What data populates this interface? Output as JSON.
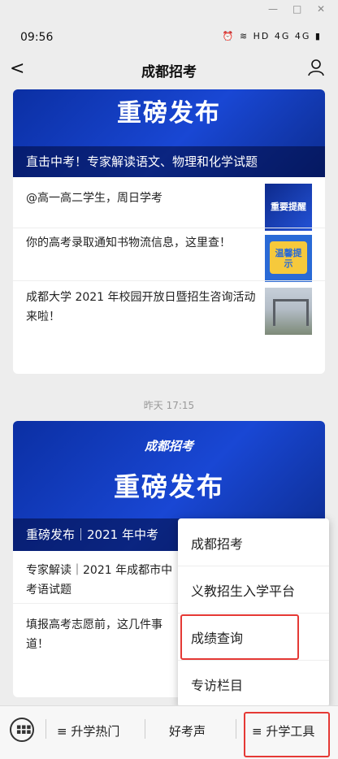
{
  "status": {
    "time": "09:56",
    "icons": "⏰ ≋ HD 4G 4G ▮"
  },
  "nav": {
    "title": "成都招考"
  },
  "article1": {
    "banner_big": "重磅发布",
    "banner_caption": "直击中考！专家解读语文、物理和化学试题",
    "items": [
      {
        "text": "@高一高二学生，周日学考",
        "thumb_text": "重要提醒"
      },
      {
        "text": "你的高考录取通知书物流信息，这里查！",
        "thumb_text": "温馨提示"
      },
      {
        "text": "成都大学 2021 年校园开放日暨招生咨询活动来啦！",
        "thumb_text": ""
      }
    ]
  },
  "timestamp": "昨天 17:15",
  "article2": {
    "banner_logo": "成都招考",
    "banner_big": "重磅发布",
    "banner_caption": "重磅发布｜2021 年中考",
    "items": [
      {
        "text": "专家解读｜2021 年成都市中考语试题"
      },
      {
        "text": "填报高考志愿前，这几件事道！"
      }
    ]
  },
  "menu": {
    "items": [
      "成都招考",
      "义教招生入学平台",
      "成绩查询",
      "专访栏目"
    ]
  },
  "bottom": {
    "tab1": "≡ 升学热门",
    "tab2": "好考声",
    "tab3": "≡ 升学工具"
  },
  "colors": {
    "highlight": "#e53935",
    "banner": "#1947d4"
  }
}
